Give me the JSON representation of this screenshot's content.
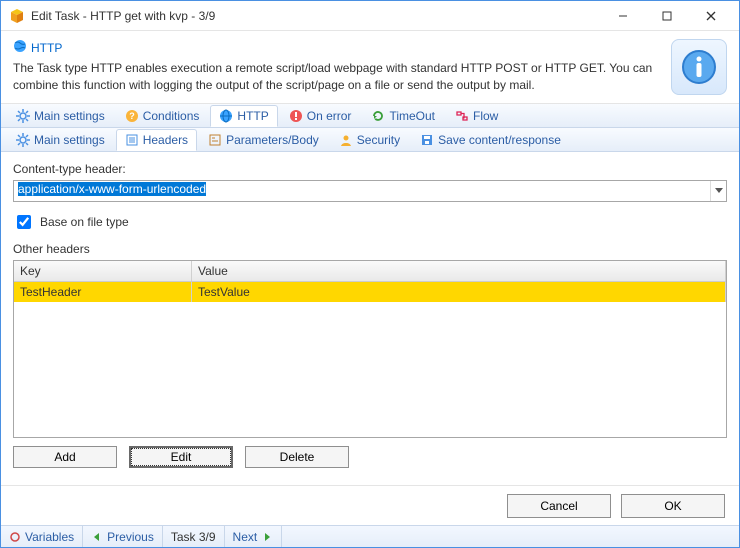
{
  "window": {
    "title": "Edit Task - HTTP get with kvp - 3/9"
  },
  "info": {
    "heading": "HTTP",
    "description": "The Task type HTTP enables execution a remote script/load webpage with standard HTTP POST or HTTP GET. You can combine this function with logging the output of the script/page on a file or send the output by mail."
  },
  "tabs_main": [
    {
      "key": "mainsettings",
      "label": "Main settings",
      "icon": "gear"
    },
    {
      "key": "conditions",
      "label": "Conditions",
      "icon": "help"
    },
    {
      "key": "http",
      "label": "HTTP",
      "icon": "globe",
      "active": true
    },
    {
      "key": "onerror",
      "label": "On error",
      "icon": "warning"
    },
    {
      "key": "timeout",
      "label": "TimeOut",
      "icon": "refresh"
    },
    {
      "key": "flow",
      "label": "Flow",
      "icon": "flow"
    }
  ],
  "tabs_sub": [
    {
      "key": "mainsettings2",
      "label": "Main settings",
      "icon": "gear"
    },
    {
      "key": "headers",
      "label": "Headers",
      "icon": "list",
      "active": true
    },
    {
      "key": "params",
      "label": "Parameters/Body",
      "icon": "form"
    },
    {
      "key": "security",
      "label": "Security",
      "icon": "user"
    },
    {
      "key": "save",
      "label": "Save content/response",
      "icon": "save"
    }
  ],
  "form": {
    "content_type_label": "Content-type header:",
    "content_type_value": "application/x-www-form-urlencoded",
    "base_on_file_type_label": "Base on file type",
    "base_on_file_type_checked": true,
    "other_headers_label": "Other headers",
    "columns": {
      "key": "Key",
      "value": "Value"
    },
    "rows": [
      {
        "key": "TestHeader",
        "value": "TestValue",
        "selected": true
      }
    ],
    "buttons": {
      "add": "Add",
      "edit": "Edit",
      "delete": "Delete"
    }
  },
  "footer": {
    "cancel": "Cancel",
    "ok": "OK"
  },
  "status": {
    "variables": "Variables",
    "previous": "Previous",
    "task": "Task 3/9",
    "next": "Next"
  }
}
